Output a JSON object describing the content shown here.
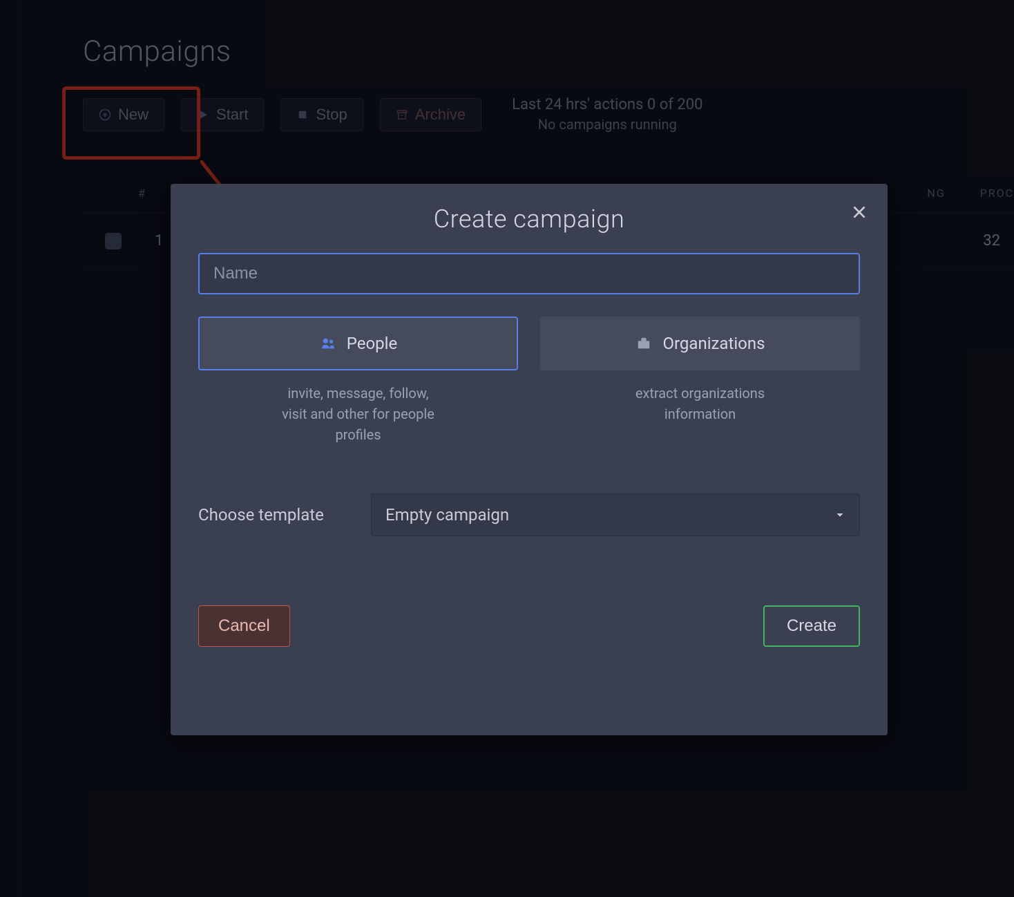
{
  "page": {
    "title": "Campaigns"
  },
  "toolbar": {
    "new_label": "New",
    "start_label": "Start",
    "stop_label": "Stop",
    "archive_label": "Archive",
    "status_line1": "Last 24 hrs' actions 0 of 200",
    "status_line2": "No campaigns running"
  },
  "table": {
    "header_num": "#",
    "header_col_a": "NG",
    "header_col_b": "PROC",
    "rows": [
      {
        "num": "1",
        "val_b": "32"
      }
    ]
  },
  "modal": {
    "title": "Create campaign",
    "name_placeholder": "Name",
    "name_value": "",
    "type_people_label": "People",
    "type_people_desc": "invite, message, follow,\nvisit and other for people\nprofiles",
    "type_org_label": "Organizations",
    "type_org_desc": "extract organizations\ninformation",
    "template_label": "Choose template",
    "template_value": "Empty campaign",
    "cancel_label": "Cancel",
    "create_label": "Create"
  }
}
